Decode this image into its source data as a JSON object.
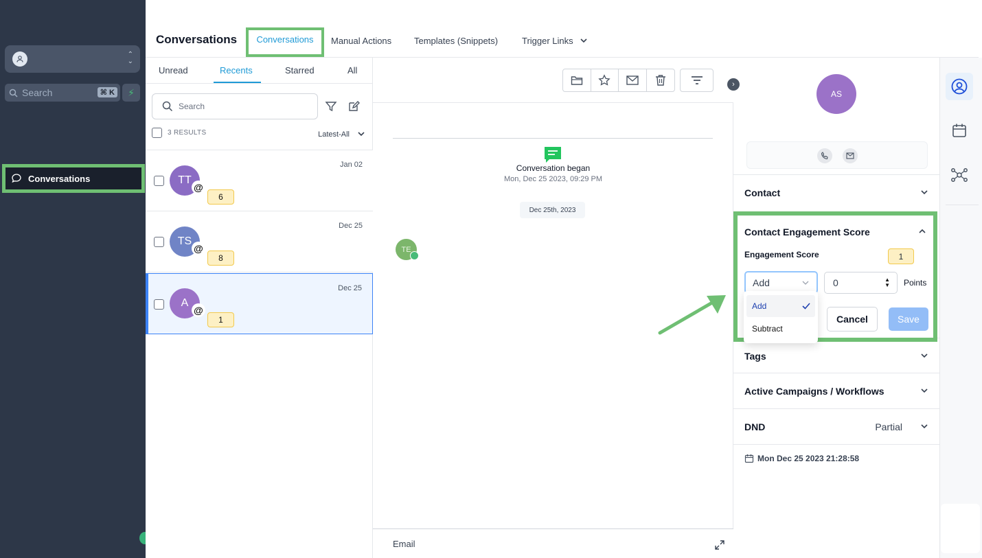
{
  "sidebar": {
    "search_label": "Search",
    "search_shortcut": "⌘ K",
    "nav_conversations": "Conversations"
  },
  "header": {
    "page_title": "Conversations",
    "tabs": [
      "Conversations",
      "Manual Actions",
      "Templates (Snippets)",
      "Trigger Links"
    ],
    "active_tab": "Conversations"
  },
  "list": {
    "filter_tabs": [
      "Unread",
      "Recents",
      "Starred",
      "All"
    ],
    "active_filter": "Recents",
    "search_placeholder": "Search",
    "results_count": "3 RESULTS",
    "sort_label": "Latest-All",
    "items": [
      {
        "initials": "TT",
        "date": "Jan 02",
        "unread": "6",
        "color": "#8b6cc4"
      },
      {
        "initials": "TS",
        "date": "Dec 25",
        "unread": "8",
        "color": "#7084c6"
      },
      {
        "initials": "A",
        "date": "Dec 25",
        "unread": "1",
        "color": "#9b72c8"
      }
    ]
  },
  "messages": {
    "conversation_began": "Conversation began",
    "conversation_began_date": "Mon, Dec 25 2023, 09:29 PM",
    "date_chip": "Dec 25th, 2023",
    "message_avatar": "TE",
    "composer_channel": "Email"
  },
  "contact": {
    "avatar_initials": "AS",
    "sections": {
      "contact": "Contact",
      "engagement": "Contact Engagement Score",
      "tags": "Tags",
      "campaigns": "Active Campaigns / Workflows",
      "dnd": "DND",
      "dnd_value": "Partial"
    },
    "engagement": {
      "score_label": "Engagement Score",
      "score_value": "1",
      "operation_value": "Add",
      "operation_options": [
        "Add",
        "Subtract"
      ],
      "points_value": "0",
      "points_label": "Points",
      "cancel_label": "Cancel",
      "save_label": "Save"
    },
    "created_date": "Mon Dec 25 2023 21:28:58"
  },
  "colors": {
    "highlight": "#6fbf73",
    "accent": "#1f9ad6",
    "sidebar_bg": "#2d3748"
  }
}
